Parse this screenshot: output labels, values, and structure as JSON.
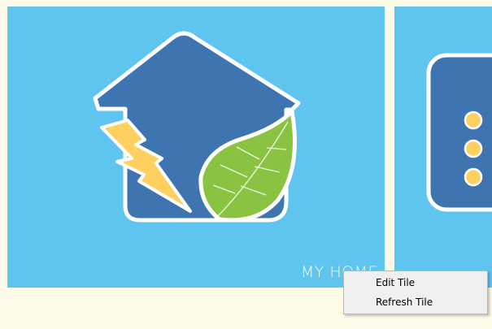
{
  "tiles": [
    {
      "label": "MY HOME",
      "icon": "green-energy-home-icon"
    },
    {
      "label": "",
      "icon": "device-dots-icon"
    }
  ],
  "context_menu": {
    "items": [
      {
        "label": "Edit Tile"
      },
      {
        "label": "Refresh Tile"
      }
    ]
  },
  "colors": {
    "background": "#fefbe9",
    "tile": "#60c5ee",
    "house": "#3e75b1",
    "bolt": "#fed060",
    "leaf": "#8ac341",
    "menu": "#f0f0f0"
  }
}
